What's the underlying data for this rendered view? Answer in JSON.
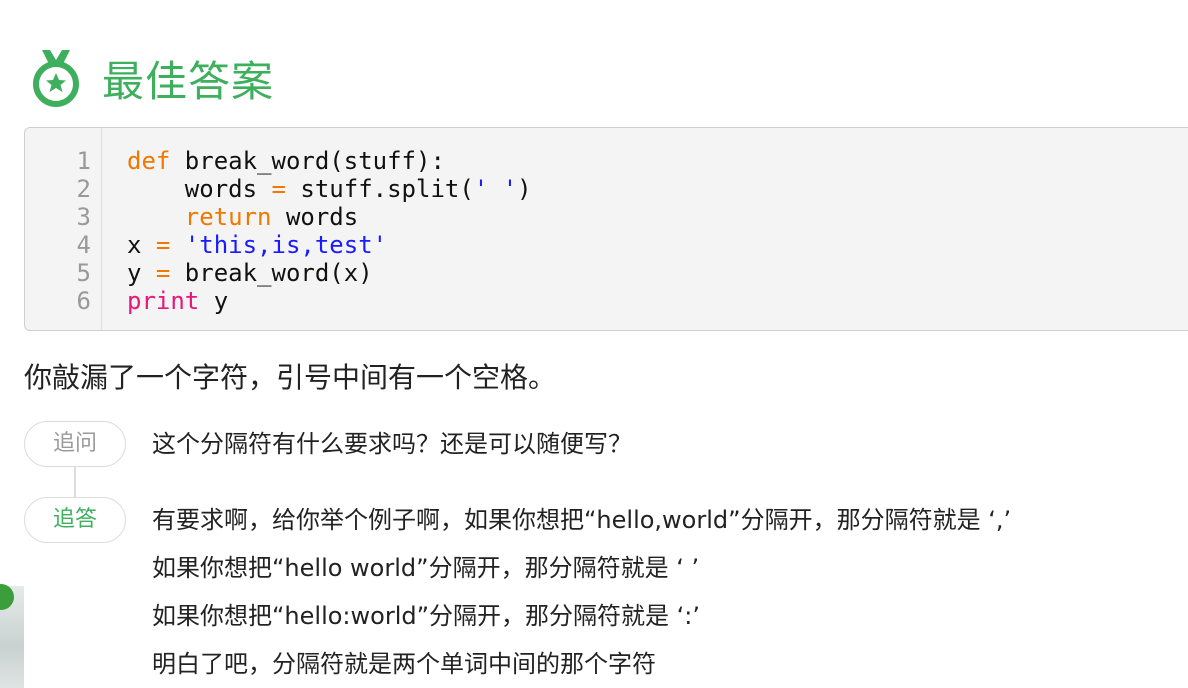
{
  "best_answer": {
    "title": "最佳答案",
    "icon": "medal-star-icon",
    "accent_color": "#3eaf5d"
  },
  "code": {
    "line_numbers": [
      "1",
      "2",
      "3",
      "4",
      "5",
      "6"
    ],
    "lines": [
      "def break_word(stuff):",
      "    words = stuff.split(' ')",
      "    return words",
      "x = 'this,is,test'",
      "y = break_word(x)",
      "print y"
    ]
  },
  "answer_text": "你敲漏了一个字符，引号中间有一个空格。",
  "follow_up": {
    "question_tag": "追问",
    "question": "这个分隔符有什么要求吗？还是可以随便写？",
    "reply_tag": "追答",
    "reply_lines": [
      "有要求啊，给你举个例子啊，如果你想把“hello,world”分隔开，那分隔符就是 ‘,’",
      "如果你想把“hello world”分隔开，那分隔符就是 ‘ ’",
      "如果你想把“hello:world”分隔开，那分隔符就是 ‘:’",
      "明白了吧，分隔符就是两个单词中间的那个字符"
    ]
  }
}
